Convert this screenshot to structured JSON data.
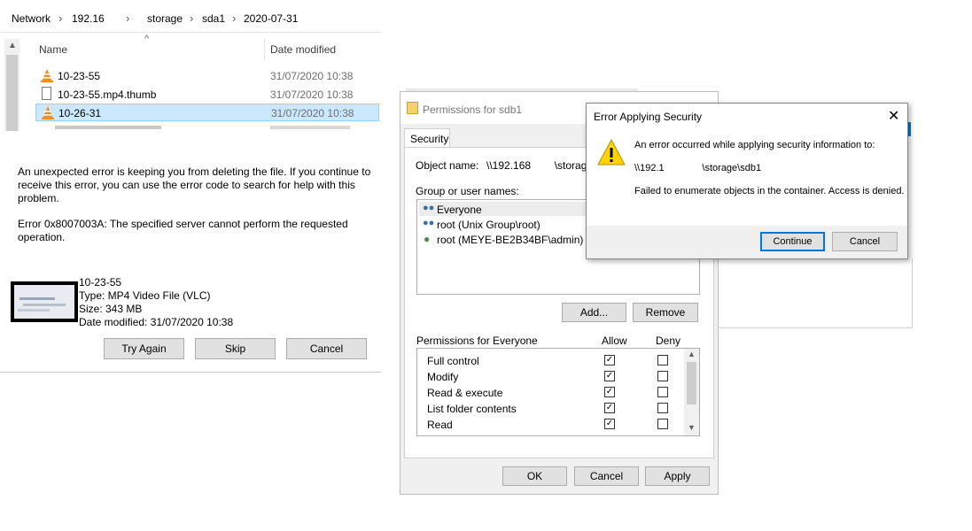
{
  "explorer": {
    "breadcrumb": [
      "Network",
      "192.16",
      "storage",
      "sda1",
      "2020-07-31"
    ],
    "columns": {
      "name": "Name",
      "date": "Date modified"
    },
    "files": [
      {
        "name": "10-23-55",
        "date": "31/07/2020 10:38"
      },
      {
        "name": "10-23-55.mp4.thumb",
        "date": "31/07/2020 10:38"
      },
      {
        "name": "10-26-31",
        "date": "31/07/2020 10:38"
      }
    ]
  },
  "delete_error": {
    "message": "An unexpected error is keeping you from deleting the file. If you continue to receive this error, you can use the error code to search for help with this problem.",
    "error_code": "Error 0x8007003A: The specified server cannot perform the requested operation.",
    "file": {
      "name": "10-23-55",
      "type": "Type: MP4 Video File (VLC)",
      "size": "Size: 343 MB",
      "modified": "Date modified: 31/07/2020 10:38"
    },
    "buttons": {
      "try_again": "Try Again",
      "skip": "Skip",
      "cancel": "Cancel"
    }
  },
  "permissions": {
    "title": "Permissions for sdb1",
    "tab": "Security",
    "object_name_label": "Object name:",
    "object_name_value": "\\\\192.168        \\storage",
    "group_label": "Group or user names:",
    "users": [
      "Everyone",
      "root (Unix Group\\root)",
      "root (MEYE-BE2B34BF\\admin)"
    ],
    "add_label": "Add...",
    "remove_label": "Remove",
    "perm_header": "Permissions for Everyone",
    "allow_header": "Allow",
    "deny_header": "Deny",
    "perms": [
      "Full control",
      "Modify",
      "Read & execute",
      "List folder contents",
      "Read"
    ],
    "ok_label": "OK",
    "cancel_label": "Cancel",
    "apply_label": "Apply"
  },
  "error_dialog": {
    "title": "Error Applying Security",
    "line1": "An error occurred while applying security information to:",
    "path": "\\\\192.1              \\storage\\sdb1",
    "line2": "Failed to enumerate objects in the container. Access is denied.",
    "continue_label": "Continue",
    "cancel_label": "Cancel"
  },
  "colors": {
    "selection": "#cce8ff",
    "focus_border": "#0078d7",
    "dialog_bg": "#f0f0f0"
  }
}
